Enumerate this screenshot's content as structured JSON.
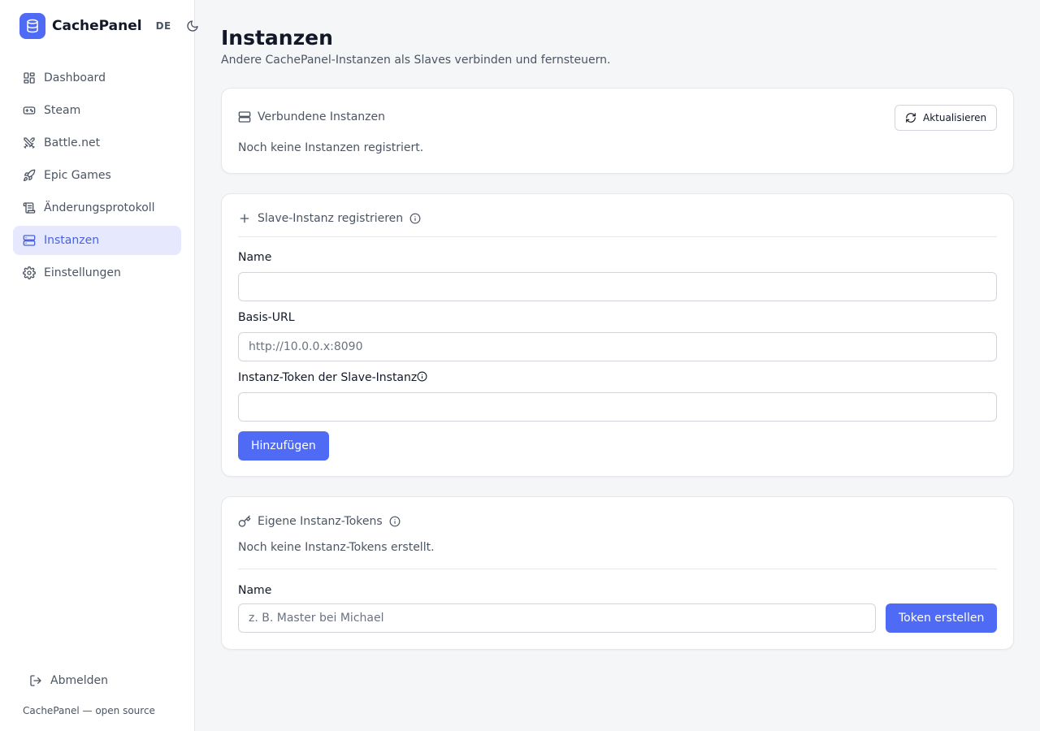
{
  "app": {
    "name": "CachePanel",
    "language": "DE",
    "theme_icon": "moon-icon",
    "accent": "#4f6bf5"
  },
  "sidebar": {
    "items": [
      {
        "label": "Dashboard",
        "icon": "dashboard-icon"
      },
      {
        "label": "Steam",
        "icon": "gamepad-icon"
      },
      {
        "label": "Battle.net",
        "icon": "swords-icon"
      },
      {
        "label": "Epic Games",
        "icon": "rocket-icon"
      },
      {
        "label": "Änderungsprotokoll",
        "icon": "scroll-icon"
      },
      {
        "label": "Instanzen",
        "icon": "server-icon",
        "active": true
      },
      {
        "label": "Einstellungen",
        "icon": "gear-icon"
      }
    ],
    "logout_label": "Abmelden",
    "footer": "CachePanel — open source"
  },
  "page": {
    "title": "Instanzen",
    "subtitle": "Andere CachePanel-Instanzen als Slaves verbinden und fernsteuern."
  },
  "connected": {
    "title": "Verbundene Instanzen",
    "refresh_label": "Aktualisieren",
    "empty": "Noch keine Instanzen registriert."
  },
  "register": {
    "title": "Slave-Instanz registrieren",
    "name_label": "Name",
    "name_value": "",
    "url_label": "Basis-URL",
    "url_placeholder": "http://10.0.0.x:8090",
    "token_label": "Instanz-Token der Slave-Instanz",
    "token_value": "",
    "submit_label": "Hinzufügen"
  },
  "tokens": {
    "title": "Eigene Instanz-Tokens",
    "empty": "Noch keine Instanz-Tokens erstellt.",
    "name_label": "Name",
    "name_placeholder": "z. B. Master bei Michael",
    "create_label": "Token erstellen"
  }
}
